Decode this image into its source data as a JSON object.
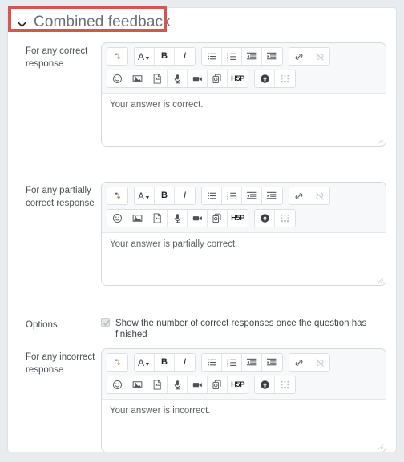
{
  "section": {
    "title": "Combined feedback",
    "collapse_icon": "chevron-down-icon",
    "expanded": true,
    "annotation_color": "#d9534f"
  },
  "toolbar": {
    "row1": [
      {
        "name": "undo-icon",
        "glyph": "undo",
        "group": 0
      },
      {
        "name": "font-color-icon",
        "glyph": "A-dropdown",
        "group": 1
      },
      {
        "name": "bold-icon",
        "glyph": "B",
        "group": 1
      },
      {
        "name": "italic-icon",
        "glyph": "I",
        "group": 1
      },
      {
        "name": "bulleted-list-icon",
        "glyph": "ul",
        "group": 2
      },
      {
        "name": "numbered-list-icon",
        "glyph": "ol",
        "group": 2
      },
      {
        "name": "decrease-indent-icon",
        "glyph": "outdent",
        "group": 2
      },
      {
        "name": "increase-indent-icon",
        "glyph": "indent",
        "group": 2
      },
      {
        "name": "link-icon",
        "glyph": "link",
        "group": 3
      },
      {
        "name": "unlink-icon",
        "glyph": "unlink",
        "group": 3
      }
    ],
    "row2": [
      {
        "name": "emoji-icon",
        "glyph": "smiley",
        "group": 0
      },
      {
        "name": "insert-image-icon",
        "glyph": "image",
        "group": 0
      },
      {
        "name": "manage-files-icon",
        "glyph": "file",
        "group": 0
      },
      {
        "name": "record-audio-icon",
        "glyph": "mic",
        "group": 0
      },
      {
        "name": "record-video-icon",
        "glyph": "video",
        "group": 0
      },
      {
        "name": "insert-media-icon",
        "glyph": "media",
        "group": 0
      },
      {
        "name": "h5p-icon",
        "glyph": "H5P",
        "group": 0
      },
      {
        "name": "accessibility-checker-icon",
        "glyph": "circle-up",
        "group": 1
      },
      {
        "name": "screenreader-helper-icon",
        "glyph": "braille",
        "group": 1
      }
    ]
  },
  "fields": [
    {
      "key": "correct",
      "label": "For any correct response",
      "editor_name": "feedback-correct-editor",
      "value": "Your answer is correct."
    },
    {
      "key": "partially_correct",
      "label": "For any partially correct response",
      "editor_name": "feedback-partially-correct-editor",
      "value": "Your answer is partially correct."
    },
    {
      "key": "incorrect",
      "label": "For any incorrect response",
      "editor_name": "feedback-incorrect-editor",
      "value": "Your answer is incorrect."
    }
  ],
  "options": {
    "label": "Options",
    "checkbox_label": "Show the number of correct responses once the question has finished",
    "checked": true,
    "disabled": true
  }
}
